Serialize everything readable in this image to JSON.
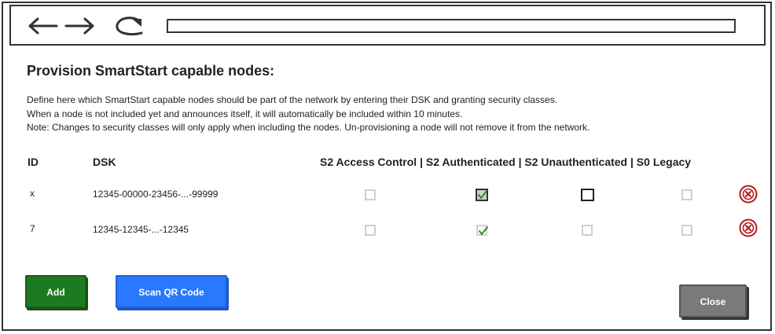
{
  "dialog": {
    "title": "Provision SmartStart capable nodes:",
    "description": [
      "Define here which SmartStart capable nodes should be part of the network by entering their DSK and granting security classes.",
      "When a node is not included yet and announces itself, it will automatically be included within 10 minutes.",
      "Note: Changes to security classes will only apply when including the nodes. Un-provisioning a node will not remove it from the network."
    ]
  },
  "table": {
    "headers": {
      "id": "ID",
      "dsk": "DSK",
      "security": "S2 Access Control | S2 Authenticated | S2 Unauthenticated | S0 Legacy"
    },
    "rows": [
      {
        "id": "x",
        "dsk": "12345-00000-23456-...-99999",
        "s2_access_control": false,
        "s2_authenticated": true,
        "s2_unauthenticated": false,
        "s0_legacy": false
      },
      {
        "id": "7",
        "dsk": "12345-12345-...-12345",
        "s2_access_control": false,
        "s2_authenticated": true,
        "s2_unauthenticated": false,
        "s0_legacy": false
      }
    ]
  },
  "buttons": {
    "add": "Add",
    "scan_qr": "Scan QR Code",
    "close": "Close"
  },
  "icons": {
    "back": "arrow-left-icon",
    "forward": "arrow-right-icon",
    "reload": "reload-icon",
    "remove": "remove-circle-icon"
  },
  "colors": {
    "add_button": "#1e7a1e",
    "scan_button": "#2979ff",
    "close_button": "#7a7a7a",
    "remove_icon": "#b01c1c",
    "check_mark": "#2e8b2e"
  }
}
